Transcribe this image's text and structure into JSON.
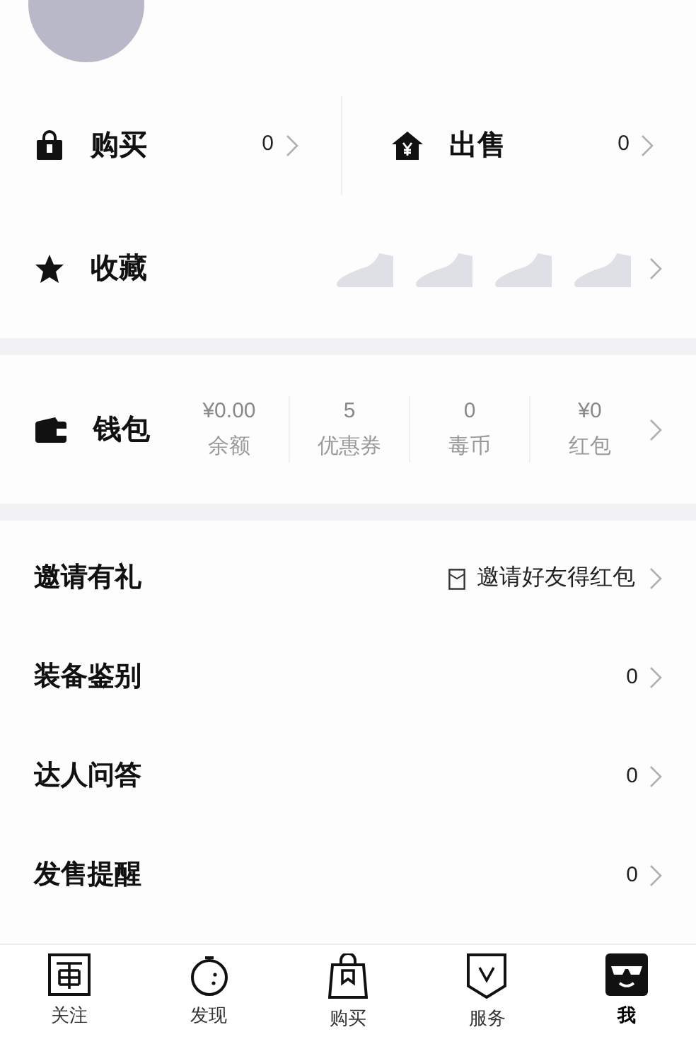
{
  "orders": [
    {
      "kind": "buy",
      "label": "购买",
      "count": "0"
    },
    {
      "kind": "sell",
      "label": "出售",
      "count": "0"
    }
  ],
  "favorites": {
    "label": "收藏"
  },
  "wallet": {
    "label": "钱包",
    "items": [
      {
        "value": "¥0.00",
        "label": "余额"
      },
      {
        "value": "5",
        "label": "优惠券"
      },
      {
        "value": "0",
        "label": "毒币"
      },
      {
        "value": "¥0",
        "label": "红包"
      }
    ]
  },
  "menu": [
    {
      "kind": "invite",
      "label": "邀请有礼",
      "value": "邀请好友得红包"
    },
    {
      "kind": "count",
      "label": "装备鉴别",
      "value": "0"
    },
    {
      "kind": "count",
      "label": "达人问答",
      "value": "0"
    },
    {
      "kind": "count",
      "label": "发售提醒",
      "value": "0"
    }
  ],
  "tabbar": [
    {
      "kind": "follow",
      "label": "关注",
      "selected": false
    },
    {
      "kind": "discover",
      "label": "发现",
      "selected": false
    },
    {
      "kind": "buy",
      "label": "购买",
      "selected": false
    },
    {
      "kind": "service",
      "label": "服务",
      "selected": false
    },
    {
      "kind": "me",
      "label": "我",
      "selected": true
    }
  ]
}
